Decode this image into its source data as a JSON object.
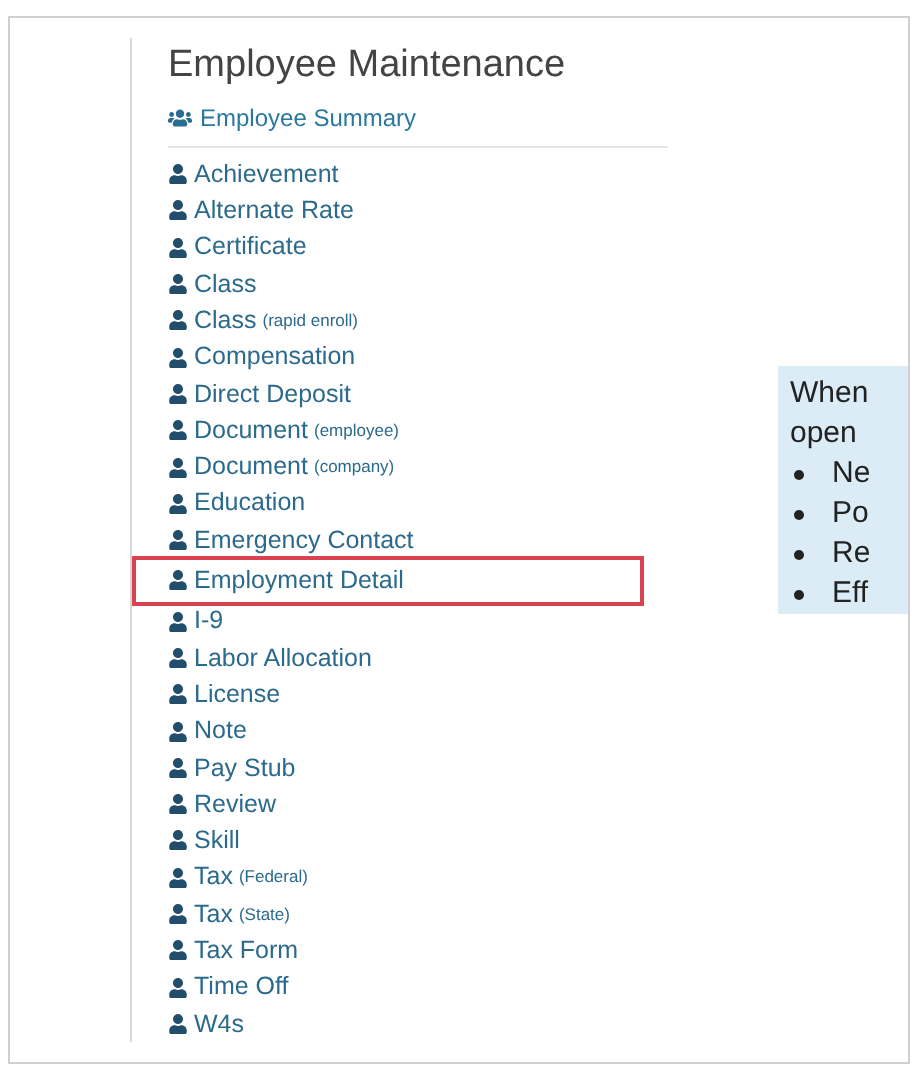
{
  "panel": {
    "title": "Employee Maintenance",
    "summary_link": "Employee Summary",
    "items": [
      {
        "label": "Achievement",
        "highlighted": false
      },
      {
        "label": "Alternate Rate",
        "highlighted": false
      },
      {
        "label": "Certificate",
        "highlighted": false
      },
      {
        "label": "Class",
        "highlighted": false
      },
      {
        "label": "Class",
        "note": "(rapid enroll)",
        "highlighted": false
      },
      {
        "label": "Compensation",
        "highlighted": false
      },
      {
        "label": "Direct Deposit",
        "highlighted": false
      },
      {
        "label": "Document",
        "note": "(employee)",
        "highlighted": false
      },
      {
        "label": "Document",
        "note": "(company)",
        "highlighted": false
      },
      {
        "label": "Education",
        "highlighted": false
      },
      {
        "label": "Emergency Contact",
        "highlighted": false
      },
      {
        "label": "Employment Detail",
        "highlighted": true
      },
      {
        "label": "I-9",
        "highlighted": false
      },
      {
        "label": "Labor Allocation",
        "highlighted": false
      },
      {
        "label": "License",
        "highlighted": false
      },
      {
        "label": "Note",
        "highlighted": false
      },
      {
        "label": "Pay Stub",
        "highlighted": false
      },
      {
        "label": "Review",
        "highlighted": false
      },
      {
        "label": "Skill",
        "highlighted": false
      },
      {
        "label": "Tax",
        "note": "(Federal)",
        "highlighted": false
      },
      {
        "label": "Tax",
        "note": "(State)",
        "highlighted": false
      },
      {
        "label": "Tax Form",
        "highlighted": false
      },
      {
        "label": "Time Off",
        "highlighted": false
      },
      {
        "label": "W4s",
        "highlighted": false
      }
    ]
  },
  "callout": {
    "lines": [
      "When",
      "open"
    ],
    "bullets": [
      "Ne",
      "Po",
      "Re",
      "Eff"
    ]
  }
}
